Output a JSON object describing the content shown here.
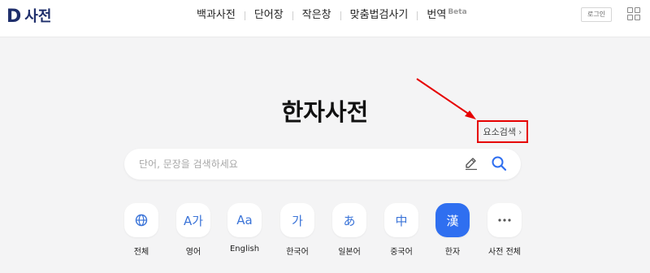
{
  "header": {
    "logo_letter": "D",
    "logo_text": "사전",
    "nav": [
      {
        "label": "백과사전"
      },
      {
        "label": "단어장"
      },
      {
        "label": "작은창"
      },
      {
        "label": "맞춤법검사기"
      },
      {
        "label": "번역",
        "badge": "Beta"
      }
    ],
    "login_label": "로그인"
  },
  "main": {
    "title": "한자사전",
    "element_search": "요소검색",
    "search": {
      "placeholder": "단어, 문장을 검색하세요",
      "value": ""
    },
    "categories": [
      {
        "label": "전체",
        "icon": "globe-icon",
        "glyph": ""
      },
      {
        "label": "영어",
        "icon": "english-icon",
        "glyph": "A가"
      },
      {
        "label": "English",
        "icon": "english-english-icon",
        "glyph": "Aa"
      },
      {
        "label": "한국어",
        "icon": "korean-icon",
        "glyph": "가"
      },
      {
        "label": "일본어",
        "icon": "japanese-icon",
        "glyph": "あ"
      },
      {
        "label": "중국어",
        "icon": "chinese-icon",
        "glyph": "中"
      },
      {
        "label": "한자",
        "icon": "hanja-icon",
        "glyph": "漢",
        "active": true
      },
      {
        "label": "사전 전체",
        "icon": "more-icon",
        "glyph": "···"
      }
    ]
  },
  "colors": {
    "accent": "#2f6ff0",
    "highlight": "#e60000",
    "brand": "#1e2e6b"
  }
}
